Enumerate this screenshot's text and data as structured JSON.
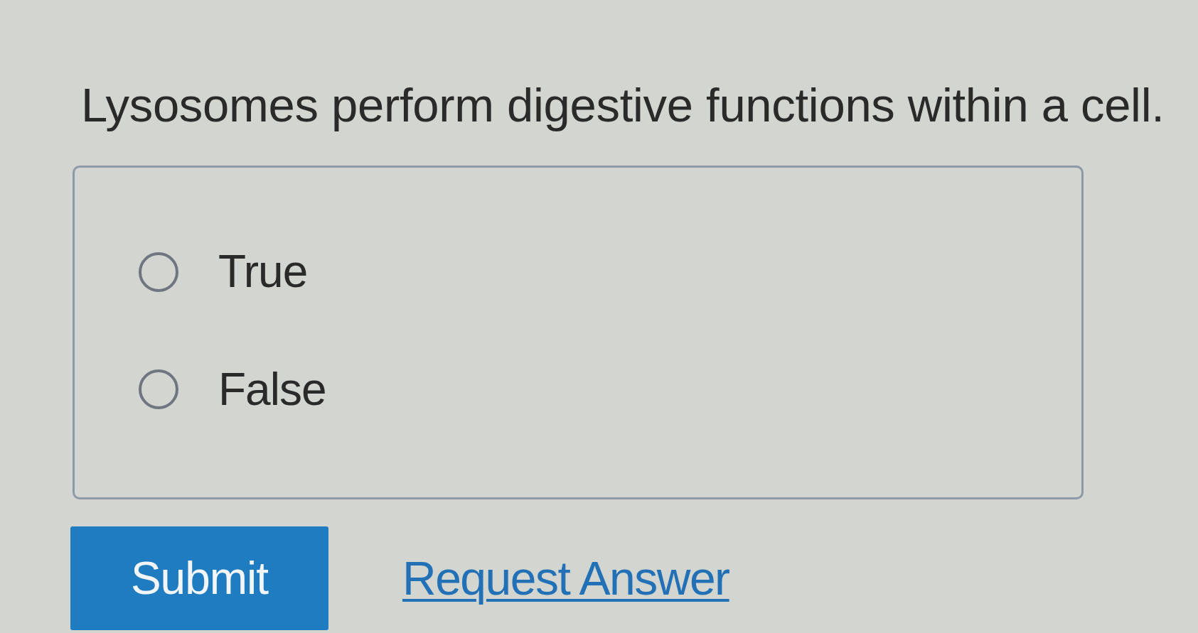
{
  "question": "Lysosomes perform digestive functions within a cell.",
  "options": [
    {
      "label": "True",
      "selected": false
    },
    {
      "label": "False",
      "selected": false
    }
  ],
  "actions": {
    "submit": "Submit",
    "request_answer": "Request Answer"
  }
}
